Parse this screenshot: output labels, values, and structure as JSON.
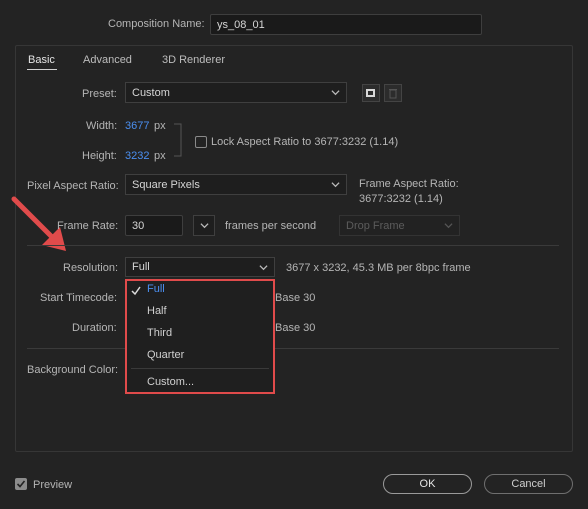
{
  "composition_name": {
    "label": "Composition Name:",
    "value": "ys_08_01"
  },
  "tabs": [
    "Basic",
    "Advanced",
    "3D Renderer"
  ],
  "preset": {
    "label": "Preset:",
    "value": "Custom"
  },
  "width": {
    "label": "Width:",
    "value": "3677",
    "unit": "px"
  },
  "height": {
    "label": "Height:",
    "value": "3232",
    "unit": "px"
  },
  "lock_aspect": {
    "label": "Lock Aspect Ratio to 3677:3232 (1.14)",
    "checked": false
  },
  "pixel_aspect": {
    "label": "Pixel Aspect Ratio:",
    "value": "Square Pixels"
  },
  "frame_aspect": {
    "label": "Frame Aspect Ratio:",
    "value": "3677:3232 (1.14)"
  },
  "frame_rate": {
    "label": "Frame Rate:",
    "value": "30",
    "unit": "frames per second",
    "drop_frame": "Drop Frame"
  },
  "resolution": {
    "label": "Resolution:",
    "value": "Full",
    "info": "3677 x 3232, 45.3 MB per 8bpc frame"
  },
  "start_timecode": {
    "label": "Start Timecode:",
    "suffix": "Base 30"
  },
  "duration": {
    "label": "Duration:",
    "suffix": "Base 30"
  },
  "background_color": {
    "label": "Background Color:"
  },
  "resolution_menu": {
    "items": [
      "Full",
      "Half",
      "Third",
      "Quarter"
    ],
    "custom": "Custom...",
    "selected": "Full"
  },
  "footer": {
    "preview_label": "Preview",
    "preview_checked": true,
    "ok_label": "OK",
    "cancel_label": "Cancel"
  },
  "colors": {
    "accent_blue": "#4b8ff0",
    "highlight_red": "#e04b4b",
    "background": "#232323"
  }
}
